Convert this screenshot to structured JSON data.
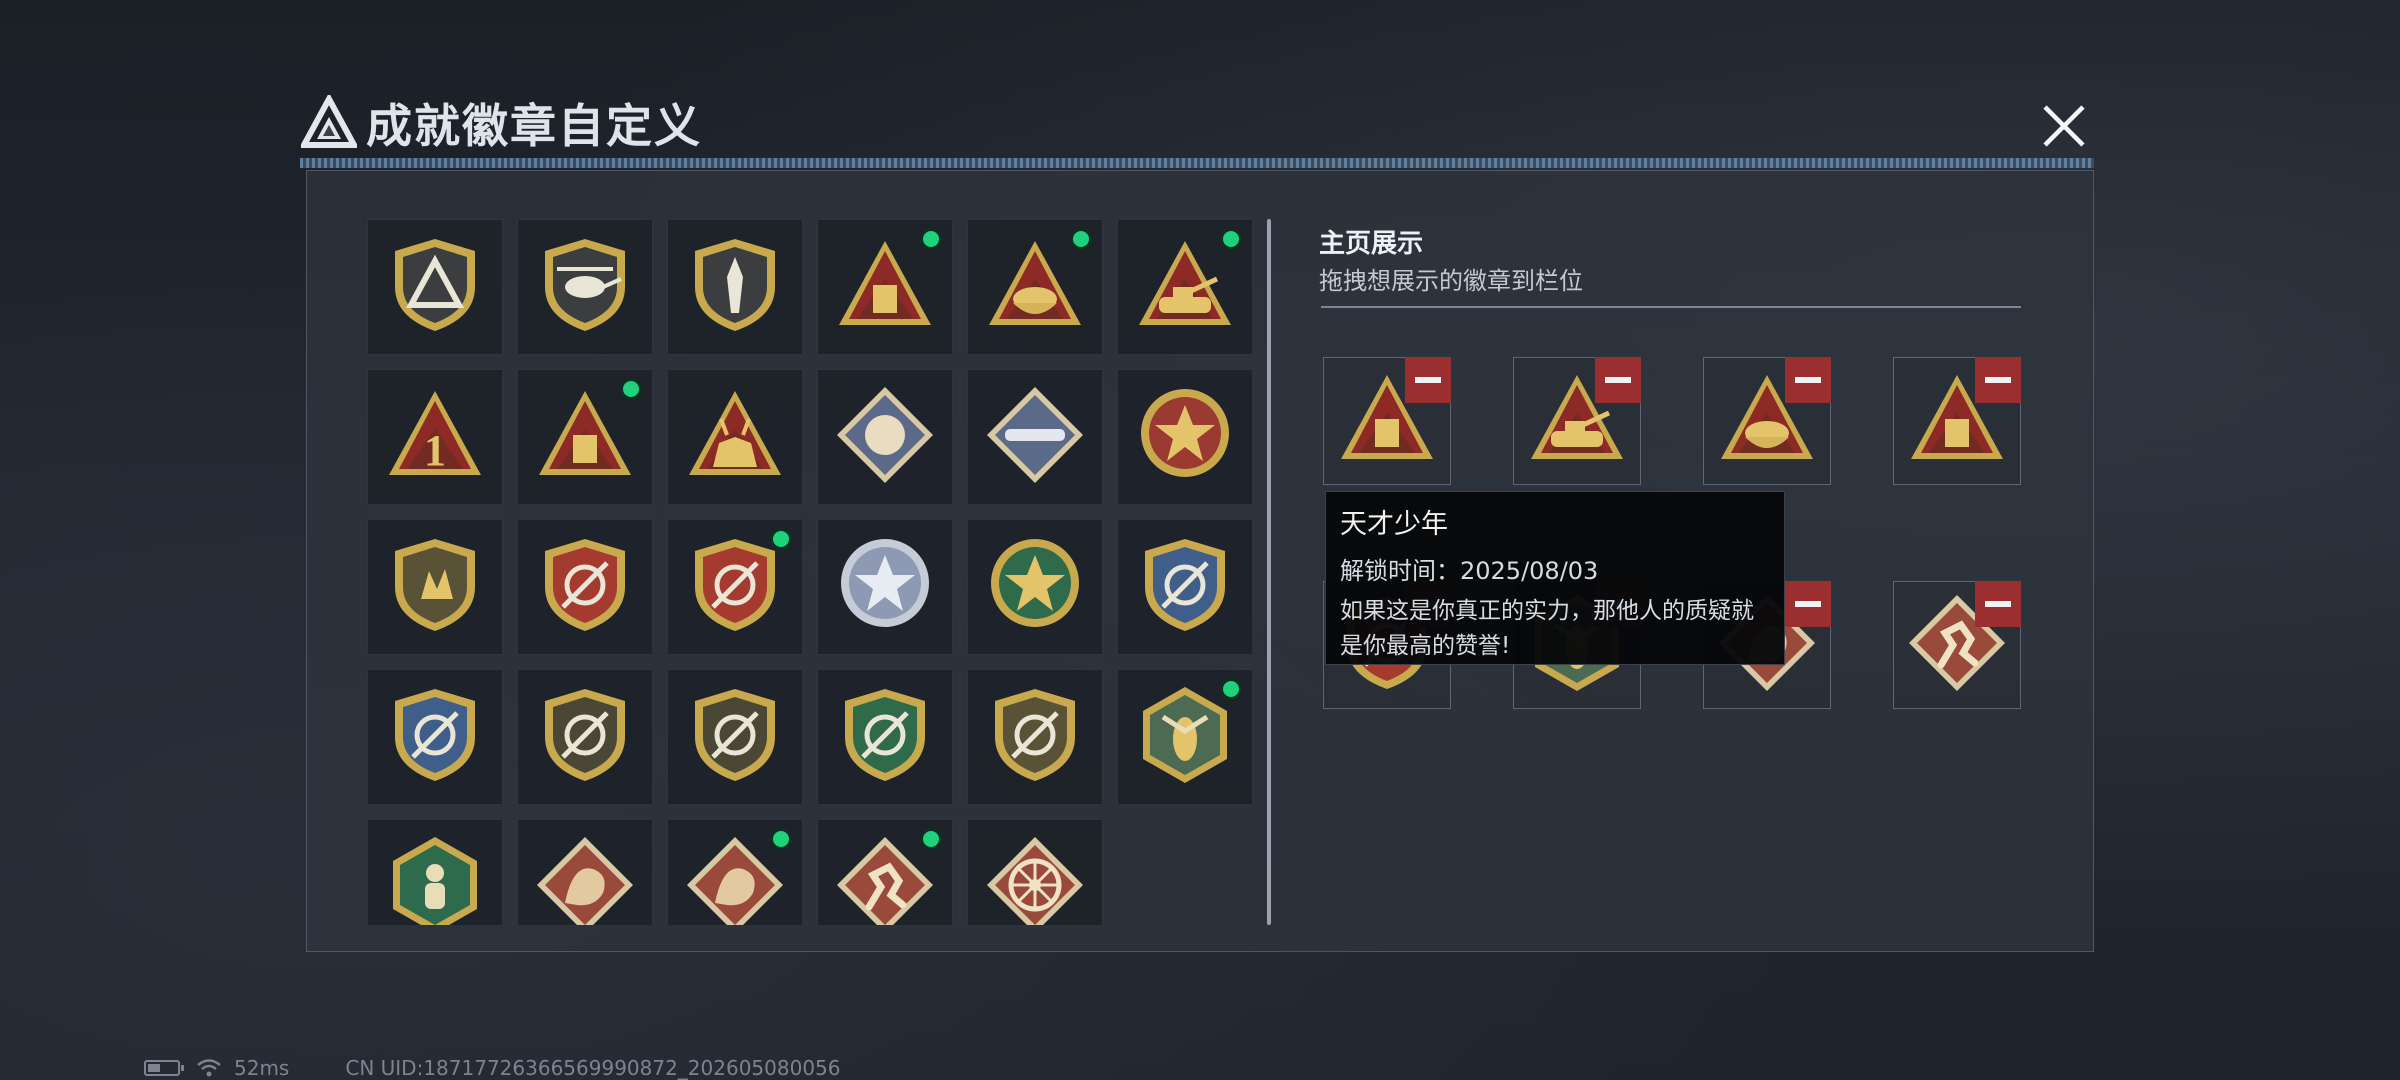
{
  "window": {
    "title": "成就徽章自定义",
    "close_icon": "close-x-icon",
    "logo_icon": "triangle-logo-icon"
  },
  "colors": {
    "new_indicator": "#1fd17a",
    "remove_button": "#9b2f2f",
    "panel_bg": "#2e343e"
  },
  "badge_grid": {
    "badges": [
      {
        "icon": "triangle-shield-badge-icon",
        "new": false
      },
      {
        "icon": "helicopter-shield-badge-icon",
        "new": false
      },
      {
        "icon": "dagger-shield-badge-icon",
        "new": false
      },
      {
        "icon": "medkit-triangle-badge-icon",
        "new": true
      },
      {
        "icon": "bread-bowl-triangle-badge-icon",
        "new": true
      },
      {
        "icon": "tank-triangle-badge-icon",
        "new": true
      },
      {
        "icon": "number-one-triangle-badge-icon",
        "new": false
      },
      {
        "icon": "usb-drive-triangle-badge-icon",
        "new": true
      },
      {
        "icon": "deer-triangle-badge-icon",
        "new": false
      },
      {
        "icon": "rose-diamond-badge-icon",
        "new": false
      },
      {
        "icon": "rocket-launcher-diamond-badge-icon",
        "new": false
      },
      {
        "icon": "star-roundel-badge-icon",
        "new": false
      },
      {
        "icon": "gold-hand-shield-badge-icon",
        "new": false
      },
      {
        "icon": "red-gold-laurel-badge-icon",
        "new": false
      },
      {
        "icon": "red-gold-stars-badge-icon",
        "new": true
      },
      {
        "icon": "silver-rose-badge-icon",
        "new": false
      },
      {
        "icon": "green-star-badge-icon",
        "new": false
      },
      {
        "icon": "blue-rifle-shield-badge-icon",
        "new": false
      },
      {
        "icon": "blue-crosshair-badge-icon",
        "new": false
      },
      {
        "icon": "olive-rifle-badge-icon",
        "new": false
      },
      {
        "icon": "olive-crosshair-badge-icon",
        "new": false
      },
      {
        "icon": "green-crosshair-badge-icon",
        "new": false
      },
      {
        "icon": "gold-crossed-rifles-badge-icon",
        "new": false
      },
      {
        "icon": "hornet-hexagon-badge-icon",
        "new": true
      },
      {
        "icon": "runner-hexagon-badge-icon",
        "new": false
      },
      {
        "icon": "dragon-diamond-badge-icon",
        "new": false
      },
      {
        "icon": "dragon-diamond-red-badge-icon",
        "new": true
      },
      {
        "icon": "sprinter-diamond-badge-icon",
        "new": true
      },
      {
        "icon": "wheel-diamond-badge-icon",
        "new": false
      }
    ]
  },
  "showcase": {
    "title": "主页展示",
    "subtitle": "拖拽想展示的徽章到栏位",
    "slots": [
      {
        "icon": "usb-drive-triangle-badge-icon"
      },
      {
        "icon": "tank-triangle-badge-icon"
      },
      {
        "icon": "bread-bowl-triangle-badge-icon"
      },
      {
        "icon": "medkit-triangle-badge-icon"
      },
      {
        "icon": "red-gold-stars-badge-icon"
      },
      {
        "icon": "hornet-hexagon-badge-icon"
      },
      {
        "icon": "dragon-diamond-red-badge-icon"
      },
      {
        "icon": "sprinter-diamond-badge-icon"
      }
    ],
    "remove_icon": "minus-icon"
  },
  "tooltip": {
    "title": "天才少年",
    "unlock_time": "解锁时间：2025/08/03",
    "description": "如果这是你真正的实力，那他人的质疑就是你最高的赞誉!"
  },
  "status": {
    "ping": "52ms",
    "uid": "CN UID:18717726366569990872_202605080056"
  }
}
